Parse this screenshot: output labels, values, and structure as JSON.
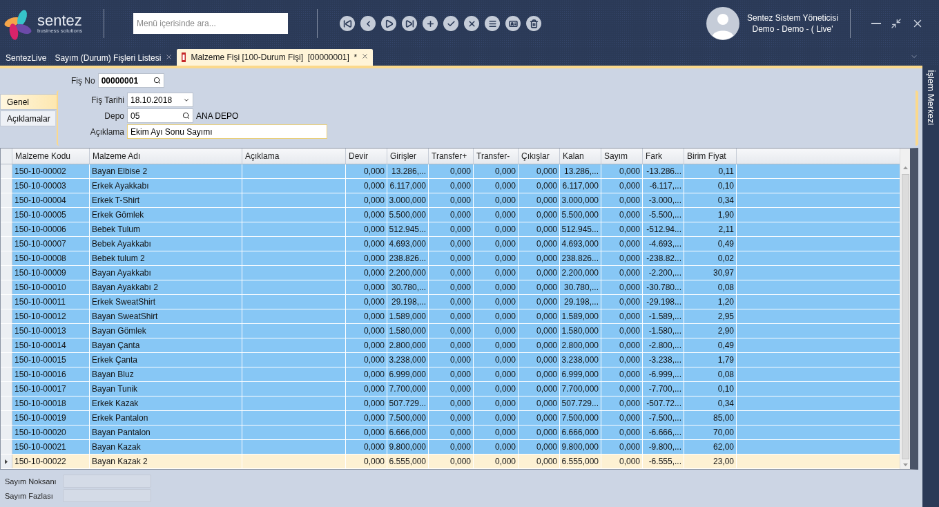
{
  "brand": {
    "name": "sentez",
    "tagline": "business solutions"
  },
  "menu_search": {
    "placeholder": "Menü içerisinde ara..."
  },
  "toolbar": [
    {
      "kind": "first"
    },
    {
      "kind": "prev"
    },
    {
      "kind": "next"
    },
    {
      "kind": "last"
    },
    {
      "kind": "add"
    },
    {
      "kind": "approve"
    },
    {
      "kind": "cancel"
    },
    {
      "kind": "list"
    },
    {
      "kind": "card"
    },
    {
      "kind": "delete"
    }
  ],
  "user": {
    "name": "Sentez Sistem Yöneticisi",
    "company": "Demo - Demo - ( Live'"
  },
  "tabs": [
    {
      "label": "SentezLive",
      "selected": false,
      "closable": false
    },
    {
      "label": "Sayım (Durum) Fişleri Listesi",
      "selected": false,
      "closable": true
    },
    {
      "label": "Malzeme Fişi [100-Durum Fişi]  [00000001]  *",
      "selected": true,
      "closable": true
    }
  ],
  "side_panel": {
    "title": "İşlem Merkezi"
  },
  "form": {
    "fis_no": {
      "label": "Fiş No",
      "value": "00000001"
    },
    "section_tabs": [
      {
        "label": "Genel",
        "selected": true
      },
      {
        "label": "Açıklamalar",
        "selected": false
      }
    ],
    "fis_tarihi": {
      "label": "Fiş Tarihi",
      "value": "18.10.2018"
    },
    "depo": {
      "label": "Depo",
      "value": "05",
      "name": "ANA DEPO"
    },
    "aciklama": {
      "label": "Açıklama",
      "value": "Ekim Ayı Sonu Sayımı"
    }
  },
  "table": {
    "columns": [
      "Malzeme Kodu",
      "Malzeme Adı",
      "Açıklama",
      "Devir",
      "Girişler",
      "Transfer+",
      "Transfer-",
      "Çıkışlar",
      "Kalan",
      "Sayım",
      "Fark",
      "Birim Fiyat"
    ],
    "rows": [
      {
        "selected": true,
        "focused": false,
        "cells": [
          "150-10-00002",
          "Bayan Elbise 2",
          "",
          "0,000",
          "13.286,...",
          "0,000",
          "0,000",
          "0,000",
          "13.286,...",
          "0,000",
          "-13.286...",
          "0,11"
        ]
      },
      {
        "selected": true,
        "focused": false,
        "cells": [
          "150-10-00003",
          "Erkek Ayakkabı",
          "",
          "0,000",
          "6.117,000",
          "0,000",
          "0,000",
          "0,000",
          "6.117,000",
          "0,000",
          "-6.117,...",
          "0,10"
        ]
      },
      {
        "selected": true,
        "focused": false,
        "cells": [
          "150-10-00004",
          "Erkek T-Shirt",
          "",
          "0,000",
          "3.000,000",
          "0,000",
          "0,000",
          "0,000",
          "3.000,000",
          "0,000",
          "-3.000,...",
          "0,34"
        ]
      },
      {
        "selected": true,
        "focused": false,
        "cells": [
          "150-10-00005",
          "Erkek Gömlek",
          "",
          "0,000",
          "5.500,000",
          "0,000",
          "0,000",
          "0,000",
          "5.500,000",
          "0,000",
          "-5.500,...",
          "1,90"
        ]
      },
      {
        "selected": true,
        "focused": false,
        "cells": [
          "150-10-00006",
          "Bebek Tulum",
          "",
          "0,000",
          "512.945...",
          "0,000",
          "0,000",
          "0,000",
          "512.945...",
          "0,000",
          "-512.94...",
          "2,11"
        ]
      },
      {
        "selected": true,
        "focused": false,
        "cells": [
          "150-10-00007",
          "Bebek Ayakkabı",
          "",
          "0,000",
          "4.693,000",
          "0,000",
          "0,000",
          "0,000",
          "4.693,000",
          "0,000",
          "-4.693,...",
          "0,49"
        ]
      },
      {
        "selected": true,
        "focused": false,
        "cells": [
          "150-10-00008",
          "Bebek tulum 2",
          "",
          "0,000",
          "238.826...",
          "0,000",
          "0,000",
          "0,000",
          "238.826...",
          "0,000",
          "-238.82...",
          "0,02"
        ]
      },
      {
        "selected": true,
        "focused": false,
        "cells": [
          "150-10-00009",
          "Bayan Ayakkabı",
          "",
          "0,000",
          "2.200,000",
          "0,000",
          "0,000",
          "0,000",
          "2.200,000",
          "0,000",
          "-2.200,...",
          "30,97"
        ]
      },
      {
        "selected": true,
        "focused": false,
        "cells": [
          "150-10-00010",
          "Bayan Ayakkabı 2",
          "",
          "0,000",
          "30.780,...",
          "0,000",
          "0,000",
          "0,000",
          "30.780,...",
          "0,000",
          "-30.780...",
          "0,08"
        ]
      },
      {
        "selected": true,
        "focused": false,
        "cells": [
          "150-10-00011",
          "Erkek SweatShirt",
          "",
          "0,000",
          "29.198,...",
          "0,000",
          "0,000",
          "0,000",
          "29.198,...",
          "0,000",
          "-29.198...",
          "1,20"
        ]
      },
      {
        "selected": true,
        "focused": false,
        "cells": [
          "150-10-00012",
          "Bayan SweatShirt",
          "",
          "0,000",
          "1.589,000",
          "0,000",
          "0,000",
          "0,000",
          "1.589,000",
          "0,000",
          "-1.589,...",
          "2,95"
        ]
      },
      {
        "selected": true,
        "focused": false,
        "cells": [
          "150-10-00013",
          "Bayan Gömlek",
          "",
          "0,000",
          "1.580,000",
          "0,000",
          "0,000",
          "0,000",
          "1.580,000",
          "0,000",
          "-1.580,...",
          "2,90"
        ]
      },
      {
        "selected": true,
        "focused": false,
        "cells": [
          "150-10-00014",
          "Bayan Çanta",
          "",
          "0,000",
          "2.800,000",
          "0,000",
          "0,000",
          "0,000",
          "2.800,000",
          "0,000",
          "-2.800,...",
          "0,49"
        ]
      },
      {
        "selected": true,
        "focused": false,
        "cells": [
          "150-10-00015",
          "Erkek Çanta",
          "",
          "0,000",
          "3.238,000",
          "0,000",
          "0,000",
          "0,000",
          "3.238,000",
          "0,000",
          "-3.238,...",
          "1,79"
        ]
      },
      {
        "selected": true,
        "focused": false,
        "cells": [
          "150-10-00016",
          "Bayan Bluz",
          "",
          "0,000",
          "6.999,000",
          "0,000",
          "0,000",
          "0,000",
          "6.999,000",
          "0,000",
          "-6.999,...",
          "0,08"
        ]
      },
      {
        "selected": true,
        "focused": false,
        "cells": [
          "150-10-00017",
          "Bayan Tunik",
          "",
          "0,000",
          "7.700,000",
          "0,000",
          "0,000",
          "0,000",
          "7.700,000",
          "0,000",
          "-7.700,...",
          "0,10"
        ]
      },
      {
        "selected": true,
        "focused": false,
        "cells": [
          "150-10-00018",
          "Erkek Kazak",
          "",
          "0,000",
          "507.729...",
          "0,000",
          "0,000",
          "0,000",
          "507.729...",
          "0,000",
          "-507.72...",
          "0,34"
        ]
      },
      {
        "selected": true,
        "focused": false,
        "cells": [
          "150-10-00019",
          "Erkek Pantalon",
          "",
          "0,000",
          "7.500,000",
          "0,000",
          "0,000",
          "0,000",
          "7.500,000",
          "0,000",
          "-7.500,...",
          "85,00"
        ]
      },
      {
        "selected": true,
        "focused": false,
        "cells": [
          "150-10-00020",
          "Bayan Pantalon",
          "",
          "0,000",
          "6.666,000",
          "0,000",
          "0,000",
          "0,000",
          "6.666,000",
          "0,000",
          "-6.666,...",
          "70,00"
        ]
      },
      {
        "selected": true,
        "focused": false,
        "cells": [
          "150-10-00021",
          "Bayan Kazak",
          "",
          "0,000",
          "9.800,000",
          "0,000",
          "0,000",
          "0,000",
          "9.800,000",
          "0,000",
          "-9.800,...",
          "62,00"
        ]
      },
      {
        "selected": false,
        "focused": true,
        "cells": [
          "150-10-00022",
          "Bayan Kazak 2",
          "",
          "0,000",
          "6.555,000",
          "0,000",
          "0,000",
          "0,000",
          "6.555,000",
          "0,000",
          "-6.555,...",
          "23,00"
        ]
      }
    ]
  },
  "totals": [
    {
      "label": "Sayım Noksanı"
    },
    {
      "label": "Sayım Fazlası"
    }
  ]
}
